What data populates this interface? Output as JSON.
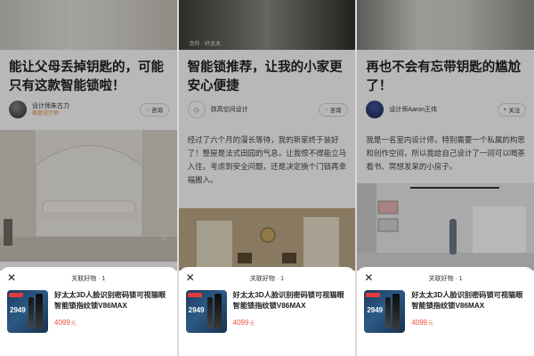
{
  "screens": [
    {
      "photo_tag": "",
      "title": "能让父母丢掉钥匙的，可能只有这款智能锁啦！",
      "author_name": "设计师朱古力",
      "author_sub": "家居设计师",
      "action_label": "咨询",
      "action_icon": "chat-icon",
      "body": "",
      "sheet_title": "关联好物 · 1",
      "product_name": "好太太3D人脸识别密码锁可视猫眼智能锁指纹锁V86MAX",
      "product_price": "4099",
      "product_price_unit": "元",
      "thumb_price": "2949"
    },
    {
      "photo_tag": "合作 · 好太太",
      "title": "智能锁推荐，让我的小家更安心便捷",
      "author_name": "弥高空间设计",
      "author_sub": "",
      "action_label": "咨询",
      "action_icon": "chat-icon",
      "body": "经过了六个月的漫长等待，我的新家终于装好了！整屋是法式田园的气息，让我恨不得能立马入住，考虑到安全问题，还是决定换个门锁再幸福搬入。",
      "sheet_title": "关联好物 · 1",
      "product_name": "好太太3D人脸识别密码锁可视猫眼智能锁指纹锁V86MAX",
      "product_price": "4099",
      "product_price_unit": "元",
      "thumb_price": "2949"
    },
    {
      "photo_tag": "",
      "title": "再也不会有忘带钥匙的尴尬了！",
      "author_name": "设计师Aaron王伟",
      "author_sub": "",
      "action_label": "关注",
      "action_icon": "plus-icon",
      "body": "我是一名室内设计师，特别需要一个私属的构思和创作空间，所以我给自己设计了一间可以喝茶看书、冥想发呆的小房子。",
      "sheet_title": "关联好物 · 1",
      "product_name": "好太太3D人脸识别密码锁可视猫眼智能锁指纹锁V86MAX",
      "product_price": "4099",
      "product_price_unit": "元",
      "thumb_price": "2949"
    }
  ],
  "colors": {
    "accent_price": "#f0503c",
    "overlay": "rgba(0,0,0,0.28)",
    "author_badge": "#f08a2e"
  }
}
